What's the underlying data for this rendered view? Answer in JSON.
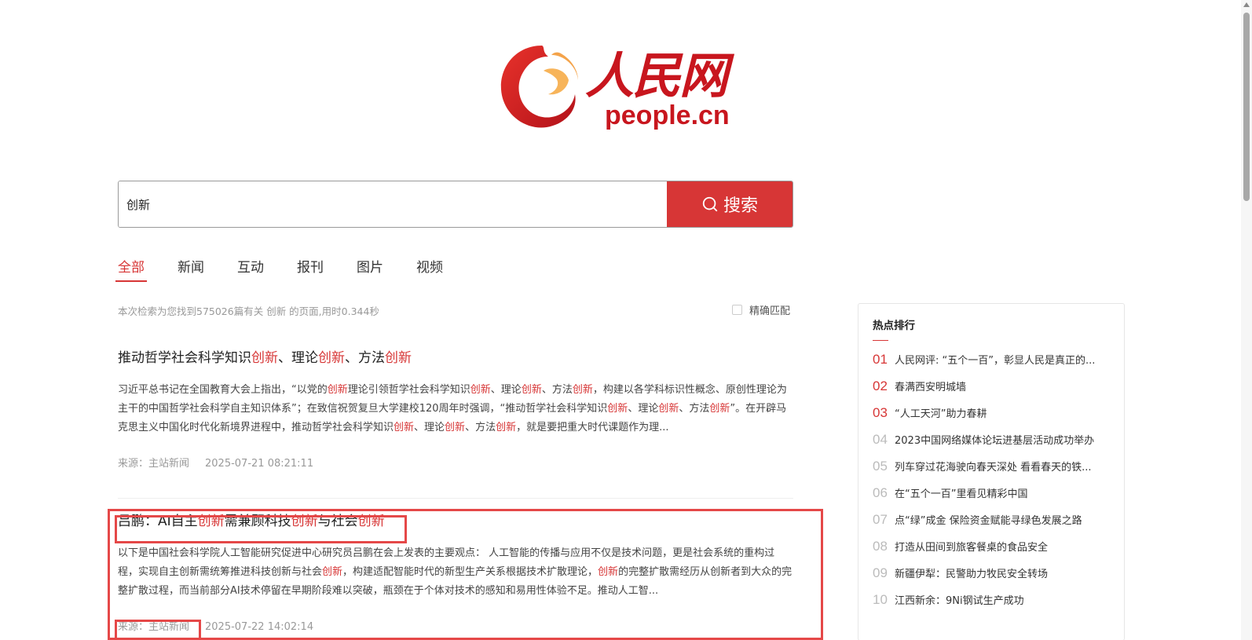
{
  "logo": {
    "cn": "人民网",
    "en": "people.cn"
  },
  "search": {
    "value": "创新",
    "button_label": "搜索"
  },
  "tabs": [
    {
      "label": "全部",
      "active": true
    },
    {
      "label": "新闻"
    },
    {
      "label": "互动"
    },
    {
      "label": "报刊"
    },
    {
      "label": "图片"
    },
    {
      "label": "视频"
    }
  ],
  "summary": "本次检索为您找到575026篇有关 创新 的页面,用时0.344秒",
  "exact_match_label": "精确匹配",
  "results": [
    {
      "title_parts": [
        "推动哲学社会科学知识",
        "创新",
        "、理论",
        "创新",
        "、方法",
        "创新"
      ],
      "body_parts": [
        "习近平总书记在全国教育大会上指出，“以党的",
        "创新",
        "理论引领哲学社会科学知识",
        "创新",
        "、理论",
        "创新",
        "、方法",
        "创新",
        "，构建以各学科标识性概念、原创性理论为主干的中国哲学社会科学自主知识体系”；在致信祝贺复旦大学建校120周年时强调，“推动哲学社会科学知识",
        "创新",
        "、理论",
        "创新",
        "、方法",
        "创新",
        "”。在开辟马克思主义中国化时代化新境界进程中，推动哲学社会科学知识",
        "创新",
        "、理论",
        "创新",
        "、方法",
        "创新",
        "，就是要把重大时代课题作为理..."
      ],
      "source": "来源：主站新闻",
      "date": "2025-07-21 08:21:11"
    },
    {
      "title_parts": [
        "吕鹏：AI自主",
        "创新",
        "需兼顾科技",
        "创新",
        "与社会",
        "创新"
      ],
      "body_parts": [
        "以下是中国社会科学院人工智能研究促进中心研究员吕鹏在会上发表的主要观点： 人工智能的传播与应用不仅是技术问题，更是社会系统的重构过程，实现自主创新需统筹推进科技创新与社会",
        "创新",
        "，构建适配智能时代的新型生产关系根据技术扩散理论，",
        "创新",
        "的完整扩散需经历从创新者到大众的完整扩散过程，而当前部分AI技术停留在早期阶段难以突破，瓶颈在于个体对技术的感知和易用性体验不足。推动人工智..."
      ],
      "source": "来源：主站新闻",
      "date": "2025-07-22 14:02:14"
    }
  ],
  "hot": {
    "title": "热点排行",
    "items": [
      {
        "num": "01",
        "text": "人民网评: “五个一百”，彰显人民是真正的..."
      },
      {
        "num": "02",
        "text": "春满西安明城墙"
      },
      {
        "num": "03",
        "text": "“人工天河”助力春耕"
      },
      {
        "num": "04",
        "text": "2023中国网络媒体论坛进基层活动成功举办"
      },
      {
        "num": "05",
        "text": "列车穿过花海驶向春天深处 看看春天的铁..."
      },
      {
        "num": "06",
        "text": "在“五个一百”里看见精彩中国"
      },
      {
        "num": "07",
        "text": "点“绿”成金 保险资金赋能寻绿色发展之路"
      },
      {
        "num": "08",
        "text": "打造从田间到旅客餐桌的食品安全"
      },
      {
        "num": "09",
        "text": "新疆伊犁：民警助力牧民安全转场"
      },
      {
        "num": "10",
        "text": "江西新余：9Ni钢试生产成功"
      }
    ]
  },
  "colors": {
    "accent": "#d73636",
    "brand_red": "#c8161e"
  }
}
